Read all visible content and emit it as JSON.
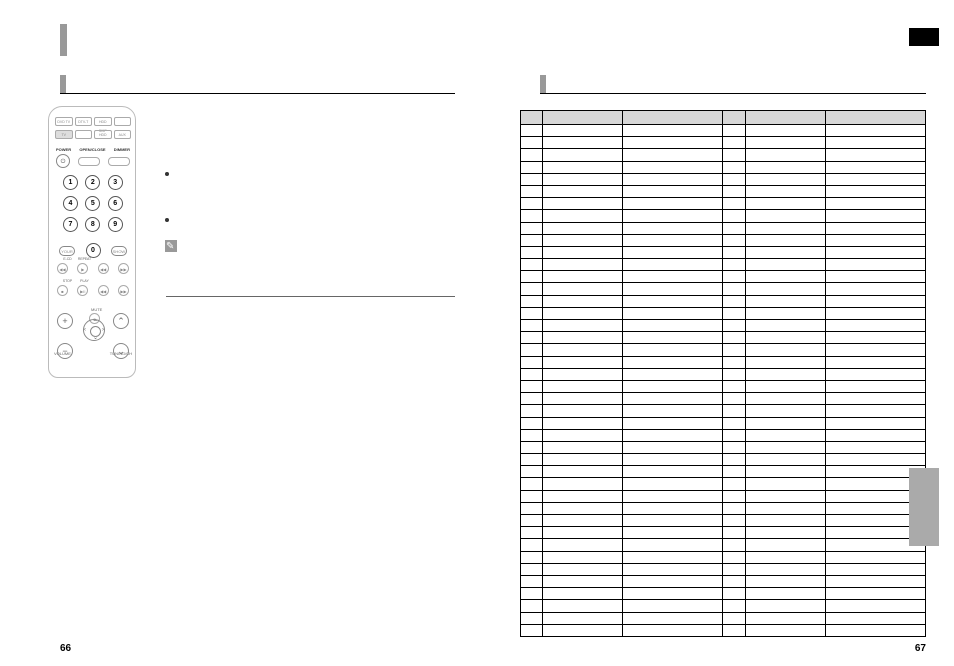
{
  "pages": {
    "left": "66",
    "right": "67"
  },
  "remote": {
    "power_label": "POWER",
    "top_right_1": "OPEN/CLOSE",
    "top_right_2": "DIMMER",
    "top_row": [
      "DVD TV",
      "DTV-T",
      "HDD SKIP",
      ""
    ],
    "row2": [
      "TV",
      "",
      "HDD",
      "AUX"
    ],
    "numbers": [
      "1",
      "2",
      "3",
      "4",
      "5",
      "6",
      "7",
      "8",
      "9",
      "0"
    ],
    "bot_pills": [
      "YOUR",
      "SHOW"
    ],
    "mid_labels_1": [
      "E-CD",
      "REPEAT",
      "",
      ""
    ],
    "mid_labels_2": [
      "STOP",
      "PLAY",
      "",
      ""
    ],
    "mid_glyphs_1": [
      "◀◀",
      "▶",
      "◀◀",
      "▶▶"
    ],
    "mid_glyphs_2": [
      "■",
      "▶II",
      "◀◀",
      "▶▶"
    ],
    "control": {
      "volume": "VOLUME",
      "tuning": "TUNING/CH",
      "mute": "MUTE"
    }
  },
  "left": {
    "bullets": [
      "",
      ""
    ],
    "note": ""
  },
  "table": {
    "headers": [
      "",
      "",
      "",
      "",
      "",
      ""
    ],
    "rows_count": 42
  }
}
